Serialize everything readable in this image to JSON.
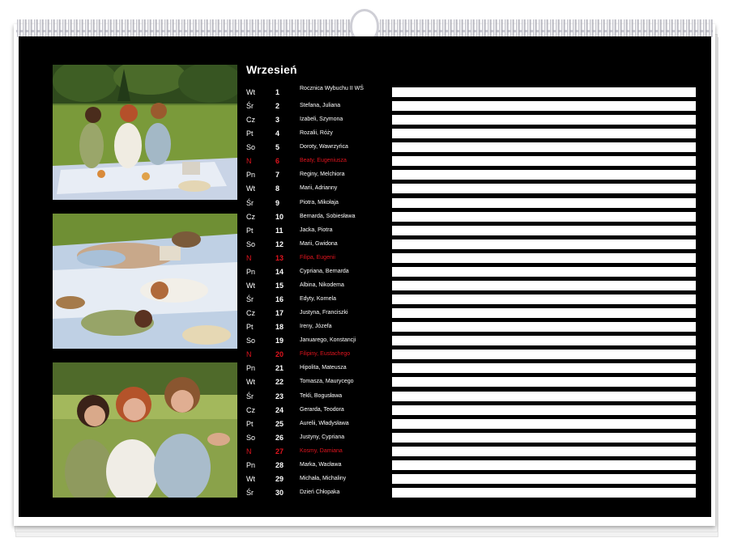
{
  "calendar": {
    "month": "Wrzesień",
    "days": [
      {
        "dow": "Wt",
        "day": "1",
        "names": "Rocznica Wybuchu II WŚ",
        "sunday": false
      },
      {
        "dow": "Śr",
        "day": "2",
        "names": "Stefana, Juliana",
        "sunday": false
      },
      {
        "dow": "Cz",
        "day": "3",
        "names": "Izabeli, Szymona",
        "sunday": false
      },
      {
        "dow": "Pt",
        "day": "4",
        "names": "Rozalii, Róży",
        "sunday": false
      },
      {
        "dow": "So",
        "day": "5",
        "names": "Doroty, Wawrzyńca",
        "sunday": false
      },
      {
        "dow": "N",
        "day": "6",
        "names": "Beaty, Eugeniusza",
        "sunday": true
      },
      {
        "dow": "Pn",
        "day": "7",
        "names": "Reginy, Melchiora",
        "sunday": false
      },
      {
        "dow": "Wt",
        "day": "8",
        "names": "Marii, Adrianny",
        "sunday": false
      },
      {
        "dow": "Śr",
        "day": "9",
        "names": "Piotra, Mikołaja",
        "sunday": false
      },
      {
        "dow": "Cz",
        "day": "10",
        "names": "Bernarda, Sobiesława",
        "sunday": false
      },
      {
        "dow": "Pt",
        "day": "11",
        "names": "Jacka, Piotra",
        "sunday": false
      },
      {
        "dow": "So",
        "day": "12",
        "names": "Marii, Gwidona",
        "sunday": false
      },
      {
        "dow": "N",
        "day": "13",
        "names": "Filipa, Eugenii",
        "sunday": true
      },
      {
        "dow": "Pn",
        "day": "14",
        "names": "Cypriana, Bernarda",
        "sunday": false
      },
      {
        "dow": "Wt",
        "day": "15",
        "names": "Albina, Nikodema",
        "sunday": false
      },
      {
        "dow": "Śr",
        "day": "16",
        "names": "Edyty, Kornela",
        "sunday": false
      },
      {
        "dow": "Cz",
        "day": "17",
        "names": "Justyna, Franciszki",
        "sunday": false
      },
      {
        "dow": "Pt",
        "day": "18",
        "names": "Ireny, Józefa",
        "sunday": false
      },
      {
        "dow": "So",
        "day": "19",
        "names": "Januarego, Konstancji",
        "sunday": false
      },
      {
        "dow": "N",
        "day": "20",
        "names": "Filipiny, Eustachego",
        "sunday": true
      },
      {
        "dow": "Pn",
        "day": "21",
        "names": "Hipolita, Mateusza",
        "sunday": false
      },
      {
        "dow": "Wt",
        "day": "22",
        "names": "Tomasza, Maurycego",
        "sunday": false
      },
      {
        "dow": "Śr",
        "day": "23",
        "names": "Tekli, Bogusława",
        "sunday": false
      },
      {
        "dow": "Cz",
        "day": "24",
        "names": "Gerarda, Teodora",
        "sunday": false
      },
      {
        "dow": "Pt",
        "day": "25",
        "names": "Aurelii, Władysława",
        "sunday": false
      },
      {
        "dow": "So",
        "day": "26",
        "names": "Justyny, Cypriana",
        "sunday": false
      },
      {
        "dow": "N",
        "day": "27",
        "names": "Kosmy, Damiana",
        "sunday": true
      },
      {
        "dow": "Pn",
        "day": "28",
        "names": "Marka, Wacława",
        "sunday": false
      },
      {
        "dow": "Wt",
        "day": "29",
        "names": "Michała, Michaliny",
        "sunday": false
      },
      {
        "dow": "Śr",
        "day": "30",
        "names": "Dzień Chłopaka",
        "sunday": false
      }
    ]
  },
  "colors": {
    "background": "#000000",
    "text": "#ffffff",
    "sunday": "#e0141e",
    "write_line": "#ffffff"
  },
  "photos": [
    "photo-picnic-eating",
    "photo-picnic-lying",
    "photo-group-hug"
  ]
}
